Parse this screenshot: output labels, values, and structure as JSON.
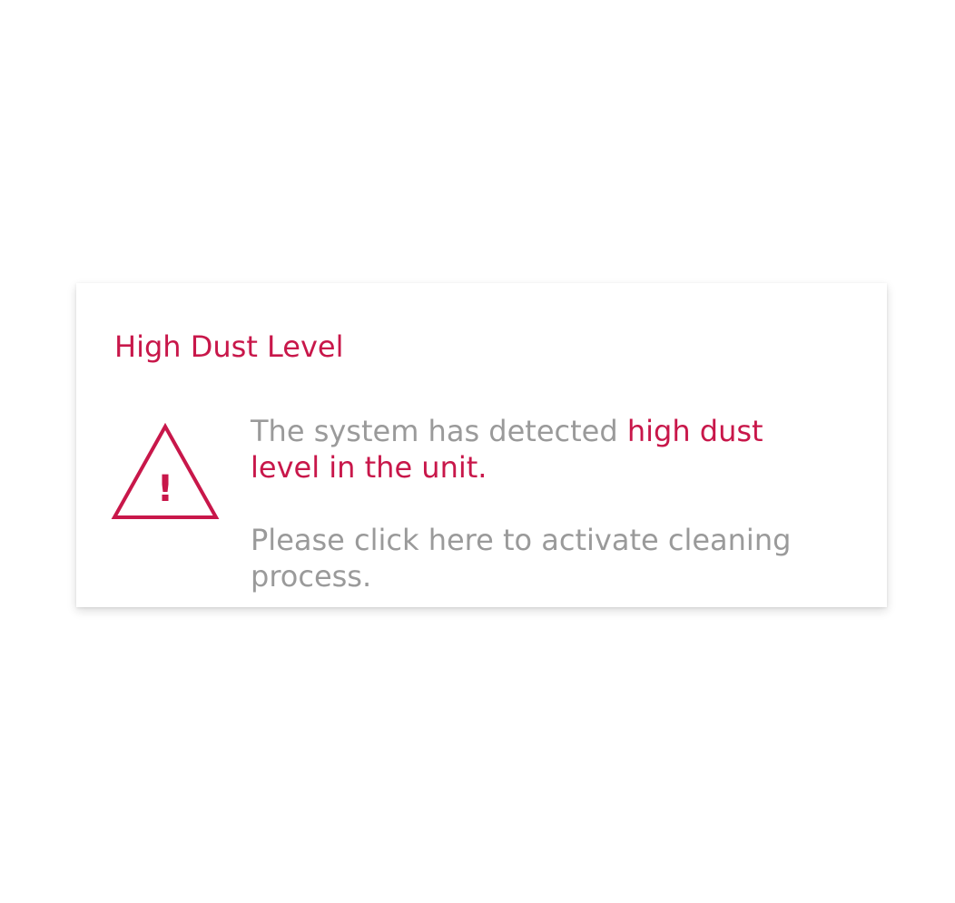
{
  "alert": {
    "title": "High Dust Level",
    "icon": "warning-triangle-icon",
    "message_prefix": "The system has detected ",
    "message_highlight": "high dust level in the unit.",
    "action_text": "Please click here to activate cleaning process.",
    "icon_glyph": "!"
  },
  "colors": {
    "accent": "#c8174a",
    "muted_text": "#9a9a9a",
    "background": "#ffffff"
  }
}
